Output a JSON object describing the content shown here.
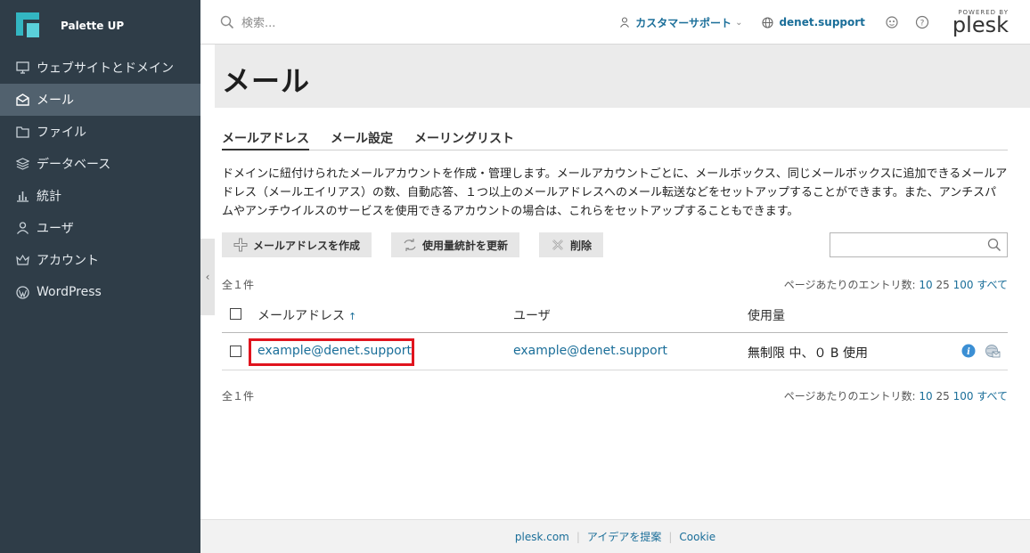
{
  "brand": {
    "name": "Palette UP"
  },
  "sidebar": {
    "items": [
      {
        "label": "ウェブサイトとドメイン",
        "icon": "monitor-icon"
      },
      {
        "label": "メール",
        "icon": "mail-icon",
        "active": true
      },
      {
        "label": "ファイル",
        "icon": "folder-icon"
      },
      {
        "label": "データベース",
        "icon": "database-icon"
      },
      {
        "label": "統計",
        "icon": "bar-chart-icon"
      },
      {
        "label": "ユーザ",
        "icon": "user-icon"
      },
      {
        "label": "アカウント",
        "icon": "crown-icon"
      },
      {
        "label": "WordPress",
        "icon": "wordpress-icon"
      }
    ]
  },
  "header": {
    "search_placeholder": "検索...",
    "support_label": "カスタマーサポート",
    "domain_label": "denet.support",
    "powered_by": "POWERED BY",
    "plesk": "plesk"
  },
  "page": {
    "title": "メール",
    "tabs": [
      "メールアドレス",
      "メール設定",
      "メーリングリスト"
    ],
    "description": "ドメインに紐付けられたメールアカウントを作成・管理します。メールアカウントごとに、メールボックス、同じメールボックスに追加できるメールアドレス（メールエイリアス）の数、自動応答、１つ以上のメールアドレスへのメール転送などをセットアップすることができます。また、アンチスパムやアンチウイルスのサービスを使用できるアカウントの場合は、これらをセットアップすることもできます。"
  },
  "toolbar": {
    "create_label": "メールアドレスを作成",
    "refresh_label": "使用量統計を更新",
    "delete_label": "削除"
  },
  "list": {
    "total": "全１件",
    "per_page_label": "ページあたりのエントリ数:",
    "per_page_options": [
      "10",
      "25",
      "100",
      "すべて"
    ],
    "columns": [
      "メールアドレス",
      "ユーザ",
      "使用量"
    ],
    "sort_arrow": "↑",
    "rows": [
      {
        "email": "example@denet.support",
        "user": "example@denet.support",
        "usage": "無制限 中、０ B 使用"
      }
    ]
  },
  "footer": {
    "links": [
      "plesk.com",
      "アイデアを提案",
      "Cookie"
    ]
  },
  "colors": {
    "accent": "#1a6e99",
    "sidebar": "#2f3d48",
    "highlight": "#e0141e"
  }
}
